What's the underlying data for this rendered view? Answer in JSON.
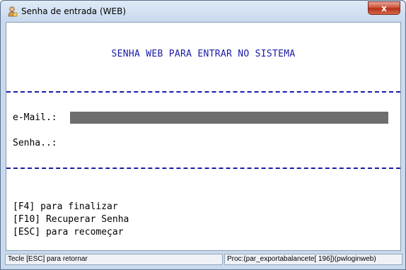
{
  "window": {
    "title": "Senha de entrada (WEB)",
    "close_label": "x"
  },
  "form": {
    "heading": "SENHA WEB PARA ENTRAR NO SISTEMA",
    "email_label": "e-Mail.:",
    "email_value": "",
    "senha_label": "Senha..:",
    "senha_value": ""
  },
  "hints": [
    "[F4] para finalizar",
    "[F10] Recuperar Senha",
    "[ESC] para recomeçar"
  ],
  "status": {
    "left": "Tecle [ESC] para retornar",
    "right": "Proc:(par_exportabalancete[   196])(pwloginweb)"
  },
  "colors": {
    "accent": "#1a1aa8",
    "input_bg": "#6e6e6e"
  }
}
